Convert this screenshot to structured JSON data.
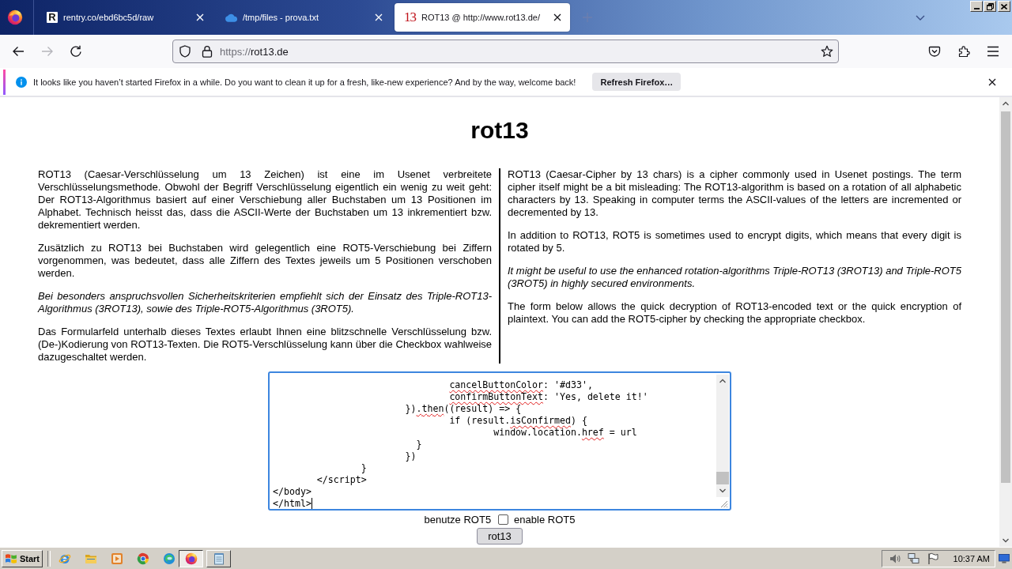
{
  "browser": {
    "tabs": [
      {
        "kind": "tile",
        "favicon": "R",
        "title": "rentry.co/ebd6bc5d/raw",
        "selected": false
      },
      {
        "kind": "cloud",
        "title": "/tmp/files - prova.txt",
        "selected": false
      },
      {
        "kind": "serif",
        "favicon": "13",
        "title": "ROT13 @ http://www.rot13.de/",
        "selected": true
      }
    ],
    "nav": {
      "back_disabled": false,
      "forward_disabled": true
    },
    "address": {
      "scheme": "https://",
      "host": "rot13.de"
    }
  },
  "notification": {
    "message": "It looks like you haven’t started Firefox in a while. Do you want to clean it up for a fresh, like-new experience? And by the way, welcome back!",
    "button": "Refresh Firefox…"
  },
  "page": {
    "title": "rot13",
    "columns": [
      {
        "paragraphs": [
          {
            "text": "ROT13 (Caesar-Verschlüsselung um 13 Zeichen) ist eine im Usenet verbreitete Verschlüsselungsmethode. Obwohl der Begriff Verschlüsselung eigentlich ein wenig zu weit geht: Der ROT13-Algorithmus basiert auf einer Verschiebung aller Buchstaben um 13 Positionen im Alphabet. Technisch heisst das, dass die ASCII-Werte der Buchstaben um 13 inkrementiert bzw. dekrementiert werden.",
            "italic": false
          },
          {
            "text": "Zusätzlich zu ROT13 bei Buchstaben wird gelegentlich eine ROT5-Verschiebung bei Ziffern vorgenommen, was bedeutet, dass alle Ziffern des Textes jeweils um 5 Positionen verschoben werden.",
            "italic": false
          },
          {
            "text": "Bei besonders anspruchsvollen Sicherheitskriterien empfiehlt sich der Einsatz des Triple-ROT13-Algorithmus (3ROT13), sowie des Triple-ROT5-Algorithmus (3ROT5).",
            "italic": true
          },
          {
            "text": "Das Formularfeld unterhalb dieses Textes erlaubt Ihnen eine blitzschnelle Verschlüsselung bzw. (De-)Kodierung von ROT13-Texten. Die ROT5-Verschlüsselung kann über die Checkbox wahlweise dazugeschaltet werden.",
            "italic": false
          }
        ]
      },
      {
        "paragraphs": [
          {
            "text": "ROT13 (Caesar-Cipher by 13 chars) is a cipher commonly used in Usenet postings. The term cipher itself might be a bit misleading: The ROT13-algorithm is based on a rotation of all alphabetic characters by 13. Speaking in computer terms the ASCII-values of the letters are incremented or decremented by 13.",
            "italic": false
          },
          {
            "text": "In addition to ROT13, ROT5 is sometimes used to encrypt digits, which means that every digit is rotated by 5.",
            "italic": false
          },
          {
            "text": "It might be useful to use the enhanced rotation-algorithms Triple-ROT13 (3ROT13) and Triple-ROT5 (3ROT5) in highly secured environments.",
            "italic": true
          },
          {
            "text": "The form below allows the quick decryption of ROT13-encoded text or the quick encryption of plaintext. You can add the ROT5-cipher by checking the appropriate checkbox.",
            "italic": false
          }
        ]
      }
    ],
    "textarea": {
      "lines": [
        {
          "segments": [
            {
              "text": "                                cancelButtonColor",
              "misspelled": true
            },
            {
              "text": ": '#d33',",
              "misspelled": false
            }
          ]
        },
        {
          "segments": [
            {
              "text": "                                confirmButtonText",
              "misspelled": true
            },
            {
              "text": ": 'Yes, delete it!'",
              "misspelled": false
            }
          ]
        },
        {
          "segments": [
            {
              "text": "                        })",
              "misspelled": false
            },
            {
              "text": ".then",
              "misspelled": true
            },
            {
              "text": "((result) => {",
              "misspelled": false
            }
          ]
        },
        {
          "segments": [
            {
              "text": "                                if (result.",
              "misspelled": false
            },
            {
              "text": "isConfirmed",
              "misspelled": true
            },
            {
              "text": ") {",
              "misspelled": false
            }
          ]
        },
        {
          "segments": [
            {
              "text": "                                        window.location.",
              "misspelled": false
            },
            {
              "text": "href",
              "misspelled": true
            },
            {
              "text": " = url",
              "misspelled": false
            }
          ]
        },
        {
          "segments": [
            {
              "text": "                          }",
              "misspelled": false
            }
          ]
        },
        {
          "segments": [
            {
              "text": "                        })",
              "misspelled": false
            }
          ]
        },
        {
          "segments": [
            {
              "text": "                }",
              "misspelled": false
            }
          ]
        },
        {
          "segments": [
            {
              "text": "        </script>",
              "misspelled": false
            }
          ]
        },
        {
          "segments": [
            {
              "text": "</body>",
              "misspelled": false
            }
          ]
        },
        {
          "segments": [
            {
              "text": "</html>",
              "misspelled": false
            }
          ]
        }
      ]
    },
    "rot5": {
      "label": "benutze ROT5",
      "checked": false,
      "label_en": "enable ROT5"
    },
    "button": "rot13"
  },
  "taskbar": {
    "start": "Start",
    "windows": [
      {
        "kind": "browser",
        "selected": true
      },
      {
        "kind": "editor",
        "selected": false
      }
    ],
    "clock": "10:37 AM"
  }
}
